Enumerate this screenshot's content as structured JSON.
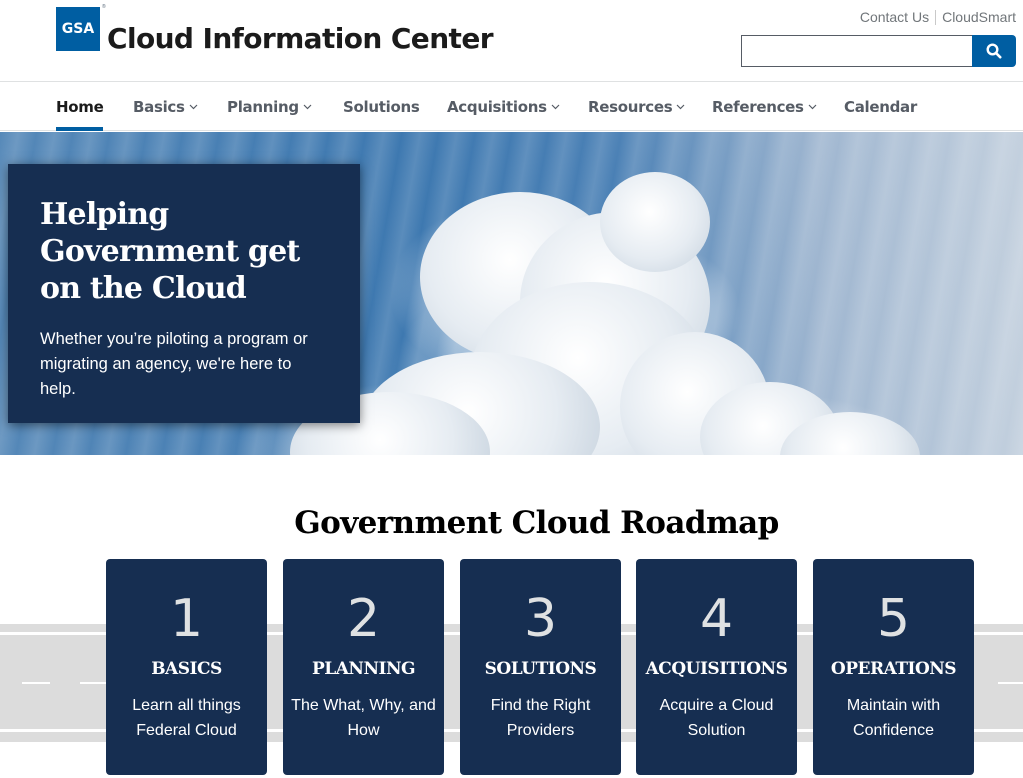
{
  "header": {
    "logo_text": "GSA",
    "logo_mark": "®",
    "site_title": "Cloud Information Center",
    "util_links": [
      "Contact Us",
      "CloudSmart"
    ],
    "search": {
      "value": "",
      "placeholder": "",
      "button_icon": "search-icon"
    }
  },
  "nav": {
    "items": [
      {
        "label": "Home",
        "active": true,
        "dropdown": false
      },
      {
        "label": "Basics",
        "active": false,
        "dropdown": true
      },
      {
        "label": "Planning",
        "active": false,
        "dropdown": true
      },
      {
        "label": "Solutions",
        "active": false,
        "dropdown": false
      },
      {
        "label": "Acquisitions",
        "active": false,
        "dropdown": true
      },
      {
        "label": "Resources",
        "active": false,
        "dropdown": true
      },
      {
        "label": "References",
        "active": false,
        "dropdown": true
      },
      {
        "label": "Calendar",
        "active": false,
        "dropdown": false
      }
    ]
  },
  "hero": {
    "title": "Helping Government get on the Cloud",
    "subtitle": "Whether you’re piloting a program or migrating an agency, we're here to help.",
    "image": "cloud-sunrays-image"
  },
  "roadmap": {
    "title": "Government Cloud Roadmap",
    "steps": [
      {
        "number": "1",
        "title": "BASICS",
        "description": "Learn all things Federal Cloud"
      },
      {
        "number": "2",
        "title": "PLANNING",
        "description": "The What, Why, and How"
      },
      {
        "number": "3",
        "title": "SOLUTIONS",
        "description": "Find the Right Providers"
      },
      {
        "number": "4",
        "title": "ACQUISITIONS",
        "description": "Acquire a Cloud Solution"
      },
      {
        "number": "5",
        "title": "OPERATIONS",
        "description": "Maintain with Confidence"
      }
    ]
  },
  "colors": {
    "primary": "#005ea2",
    "navy": "#162e51",
    "road": "#dcdcdc"
  }
}
